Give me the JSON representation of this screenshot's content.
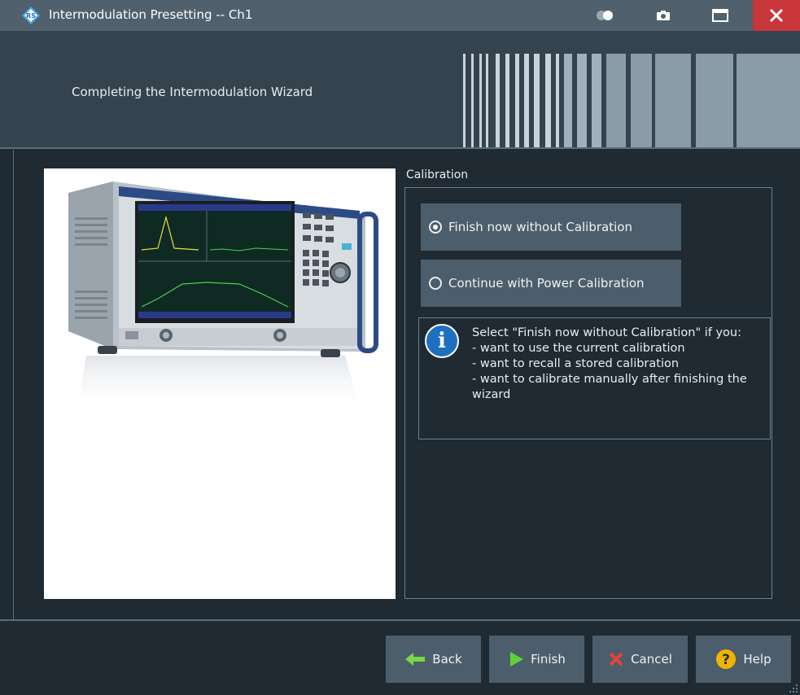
{
  "window": {
    "title": "Intermodulation Presetting -- Ch1"
  },
  "header": {
    "title": "Completing the Intermodulation Wizard"
  },
  "calibration": {
    "group_label": "Calibration",
    "options": [
      {
        "label": "Finish now without Calibration",
        "checked": true
      },
      {
        "label": "Continue with Power Calibration",
        "checked": false
      }
    ],
    "info_text": "Select \"Finish now without Calibration\" if you:\n- want to use the current calibration\n- want to recall a stored calibration\n- want to calibrate manually after finishing the wizard"
  },
  "footer": {
    "back_label": "Back",
    "finish_label": "Finish",
    "cancel_label": "Cancel",
    "help_label": "Help"
  },
  "icons": {
    "logo": "rohde-schwarz-logo-icon",
    "toggle": "toggle-icon",
    "camera": "camera-icon",
    "maximize": "maximize-icon",
    "close": "close-icon",
    "info": "info-icon",
    "back": "arrow-left-icon",
    "finish": "play-icon",
    "cancel": "cross-icon",
    "help": "question-icon"
  },
  "colors": {
    "close_button": "#c8363a",
    "back_arrow": "#7ad64a",
    "finish_arrow": "#5fd13a",
    "cancel_cross": "#e8413c",
    "help_circle": "#f0b400",
    "info_circle": "#1f6fc0"
  }
}
